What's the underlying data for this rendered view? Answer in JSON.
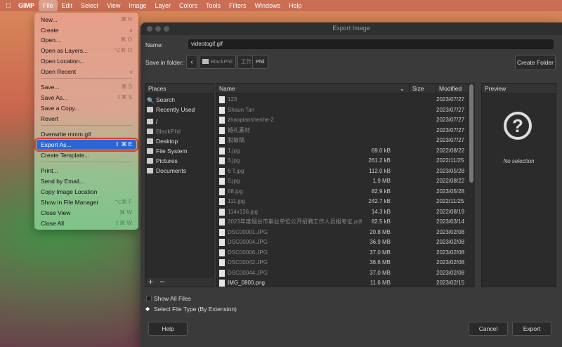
{
  "menubar": {
    "app": "GIMP",
    "items": [
      "File",
      "Edit",
      "Select",
      "View",
      "Image",
      "Layer",
      "Colors",
      "Tools",
      "Filters",
      "Windows",
      "Help"
    ]
  },
  "file_menu": {
    "items": [
      {
        "label": "New...",
        "shortcut": "⌘ N"
      },
      {
        "label": "Create",
        "submenu": true
      },
      {
        "label": "Open...",
        "shortcut": "⌘ O"
      },
      {
        "label": "Open as Layers...",
        "shortcut": "⌥⌘ O"
      },
      {
        "label": "Open Location...",
        "shortcut": ""
      },
      {
        "label": "Open Recent",
        "submenu": true
      },
      {
        "label": "Save...",
        "shortcut": "⌘ S"
      },
      {
        "label": "Save As...",
        "shortcut": "⇧⌘ S"
      },
      {
        "label": "Save a Copy...",
        "shortcut": ""
      },
      {
        "label": "Revert",
        "shortcut": ""
      },
      {
        "label": "Overwrite mmm.gif",
        "shortcut": ""
      },
      {
        "label": "Export As...",
        "shortcut": "⇧ ⌘ E",
        "selected": true
      },
      {
        "label": "Create Template...",
        "shortcut": ""
      },
      {
        "label": "Print...",
        "shortcut": ""
      },
      {
        "label": "Send by Email...",
        "shortcut": ""
      },
      {
        "label": "Copy Image Location",
        "shortcut": ""
      },
      {
        "label": "Show in File Manager",
        "shortcut": "⌥⌘ F"
      },
      {
        "label": "Close View",
        "shortcut": "⌘ W"
      },
      {
        "label": "Close All",
        "shortcut": "⇧⌘ W"
      }
    ]
  },
  "dialog": {
    "title": "Export Image",
    "name_label": "Name:",
    "name_value": "videotogif.gif",
    "folder_label": "Save in folder:",
    "crumbs": [
      "BlackPhil",
      "工作",
      "Phil"
    ],
    "create_folder": "Create Folder",
    "places": {
      "header": "Places",
      "items": [
        "Search",
        "Recently Used",
        "/",
        "BlackPhil",
        "Desktop",
        "File System",
        "Pictures",
        "Documents"
      ],
      "add": "+",
      "remove": "−"
    },
    "columns": {
      "name": "Name",
      "size": "Size",
      "modified": "Modified"
    },
    "files": [
      {
        "name": "123",
        "size": "",
        "modified": "2023/07/27"
      },
      {
        "name": "Shaun Tan",
        "size": "",
        "modified": "2023/07/27"
      },
      {
        "name": "zhaopianshenhe-2",
        "size": "",
        "modified": "2023/07/27"
      },
      {
        "name": "婚礼素材",
        "size": "",
        "modified": "2023/07/27"
      },
      {
        "name": "脱敏稿",
        "size": "",
        "modified": "2023/07/27"
      },
      {
        "name": "1.jpg",
        "size": "69.0 kB",
        "modified": "2022/08/22"
      },
      {
        "name": "3.jpg",
        "size": "261.2 kB",
        "modified": "2022/11/25"
      },
      {
        "name": "6 T.jpg",
        "size": "112.0 kB",
        "modified": "2023/05/28"
      },
      {
        "name": "9.jpg",
        "size": "1.9 MB",
        "modified": "2022/08/22"
      },
      {
        "name": "88.jpg",
        "size": "82.9 kB",
        "modified": "2023/05/28"
      },
      {
        "name": "111.jpg",
        "size": "242.7 kB",
        "modified": "2022/11/25"
      },
      {
        "name": "114x136.jpg",
        "size": "14.3 kB",
        "modified": "2022/08/19"
      },
      {
        "name": "2023年度烟台市事业单位公开招聘工作人员报考证.pdf",
        "size": "82.5 kB",
        "modified": "2023/03/14"
      },
      {
        "name": "DSC00001.JPG",
        "size": "20.8 MB",
        "modified": "2023/02/08"
      },
      {
        "name": "DSC00004.JPG",
        "size": "36.9 MB",
        "modified": "2023/02/08"
      },
      {
        "name": "DSC00006.JPG",
        "size": "37.0 MB",
        "modified": "2023/02/08"
      },
      {
        "name": "DSC00042.JPG",
        "size": "36.6 MB",
        "modified": "2023/02/08"
      },
      {
        "name": "DSC00044.JPG",
        "size": "37.0 MB",
        "modified": "2023/02/08"
      },
      {
        "name": "IMG_0800.png",
        "size": "11.6 MB",
        "modified": "2023/02/15"
      }
    ],
    "preview": {
      "header": "Preview",
      "no_selection": "No selection"
    },
    "show_all_files": "Show All Files",
    "select_file_type": "Select File Type (By Extension)",
    "buttons": {
      "help": "Help",
      "cancel": "Cancel",
      "export": "Export"
    }
  }
}
